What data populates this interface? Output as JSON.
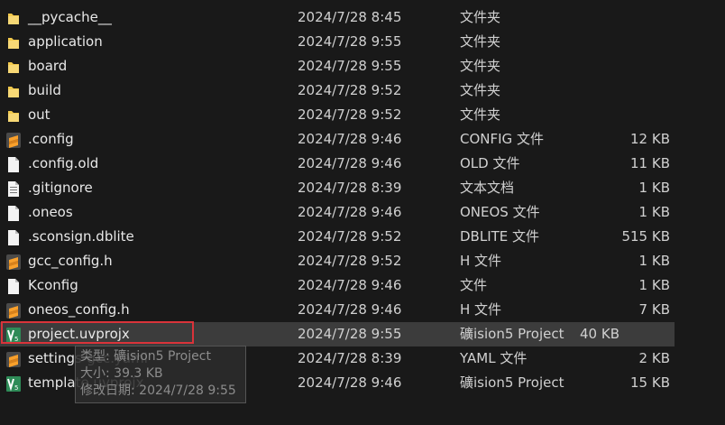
{
  "files": [
    {
      "name": "__pycache__",
      "date": "2024/7/28 8:45",
      "type": "文件夹",
      "size": "",
      "icon": "folder-icon"
    },
    {
      "name": "application",
      "date": "2024/7/28 9:55",
      "type": "文件夹",
      "size": "",
      "icon": "folder-icon"
    },
    {
      "name": "board",
      "date": "2024/7/28 9:55",
      "type": "文件夹",
      "size": "",
      "icon": "folder-icon"
    },
    {
      "name": "build",
      "date": "2024/7/28 9:52",
      "type": "文件夹",
      "size": "",
      "icon": "folder-icon"
    },
    {
      "name": "out",
      "date": "2024/7/28 9:52",
      "type": "文件夹",
      "size": "",
      "icon": "folder-icon"
    },
    {
      "name": ".config",
      "date": "2024/7/28 9:46",
      "type": "CONFIG 文件",
      "size": "12 KB",
      "icon": "sublime-file-icon"
    },
    {
      "name": ".config.old",
      "date": "2024/7/28 9:46",
      "type": "OLD 文件",
      "size": "11 KB",
      "icon": "blank-file-icon"
    },
    {
      "name": ".gitignore",
      "date": "2024/7/28 8:39",
      "type": "文本文档",
      "size": "1 KB",
      "icon": "text-file-icon"
    },
    {
      "name": ".oneos",
      "date": "2024/7/28 9:46",
      "type": "ONEOS 文件",
      "size": "1 KB",
      "icon": "blank-file-icon"
    },
    {
      "name": ".sconsign.dblite",
      "date": "2024/7/28 9:52",
      "type": "DBLITE 文件",
      "size": "515 KB",
      "icon": "blank-file-icon"
    },
    {
      "name": "gcc_config.h",
      "date": "2024/7/28 9:52",
      "type": "H 文件",
      "size": "1 KB",
      "icon": "sublime-file-icon"
    },
    {
      "name": "Kconfig",
      "date": "2024/7/28 9:46",
      "type": "文件",
      "size": "1 KB",
      "icon": "blank-file-icon"
    },
    {
      "name": "oneos_config.h",
      "date": "2024/7/28 9:46",
      "type": "H 文件",
      "size": "7 KB",
      "icon": "sublime-file-icon"
    },
    {
      "name": "project.uvprojx",
      "date": "2024/7/28 9:55",
      "type": "礦ision5 Project",
      "size": "40 KB",
      "icon": "keil-project-icon",
      "selected": true
    },
    {
      "name": "settings-gcc.yaml",
      "date": "2024/7/28 8:39",
      "type": "YAML 文件",
      "size": "2 KB",
      "icon": "sublime-file-icon"
    },
    {
      "name": "template.uvprojx",
      "date": "2024/7/28 9:46",
      "type": "礦ision5 Project",
      "size": "15 KB",
      "icon": "keil-project-icon"
    }
  ],
  "tooltip": {
    "type_line": "类型: 礦ision5 Project",
    "size_line": "大小: 39.3 KB",
    "modified_line": "修改日期: 2024/7/28 9:55"
  },
  "colors": {
    "background": "#191919",
    "selected_row": "#3c3c3c",
    "highlight_border": "#d9333a",
    "folder": "#f2c94c",
    "sublime": "#f9a02b",
    "keil": "#2e8b57"
  }
}
